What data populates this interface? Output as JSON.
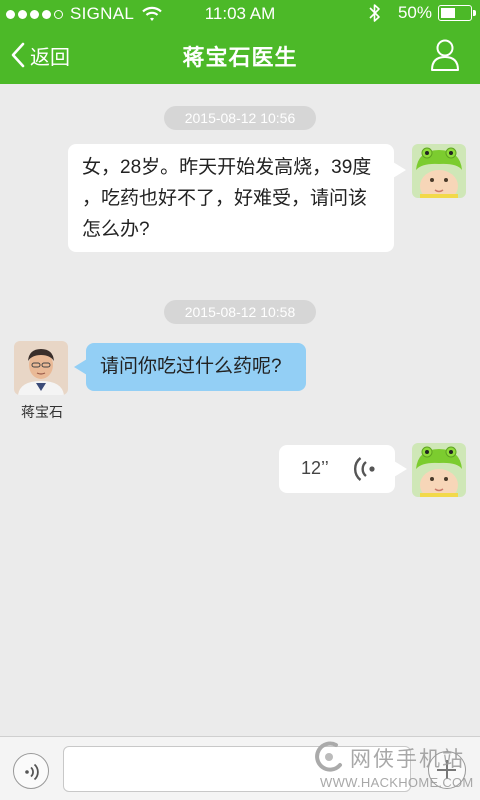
{
  "status_bar": {
    "carrier": "SIGNAL",
    "time": "11:03 AM",
    "battery": "50%",
    "battery_level": 0.5
  },
  "nav": {
    "back_label": "返回",
    "title": "蒋宝石医生"
  },
  "messages": [
    {
      "timestamp": "2015-08-12 10:56",
      "sender": "patient",
      "text": "女，28岁。昨天开始发高烧，39度，吃药也好不了，好难受，请问该怎么办?"
    },
    {
      "timestamp": "2015-08-12 10:58",
      "sender": "doctor",
      "sender_name": "蒋宝石",
      "text": "请问你吃过什么药呢?"
    },
    {
      "sender": "patient",
      "type": "voice",
      "duration": "12’’"
    }
  ],
  "msg1_lines": [
    "女，28岁。昨天开始发高烧，39度",
    "，吃药也好不了，好难受，请问该",
    "怎么办?"
  ],
  "composer": {
    "value": "",
    "placeholder": ""
  },
  "watermark": {
    "text_cn": "网侠手机站",
    "text_en": "WWW.HACKHOME.COM"
  },
  "colors": {
    "header": "#4cb928",
    "doctor_bubble": "#93cff5",
    "patient_bubble": "#ffffff",
    "chat_background": "#ebebeb"
  }
}
